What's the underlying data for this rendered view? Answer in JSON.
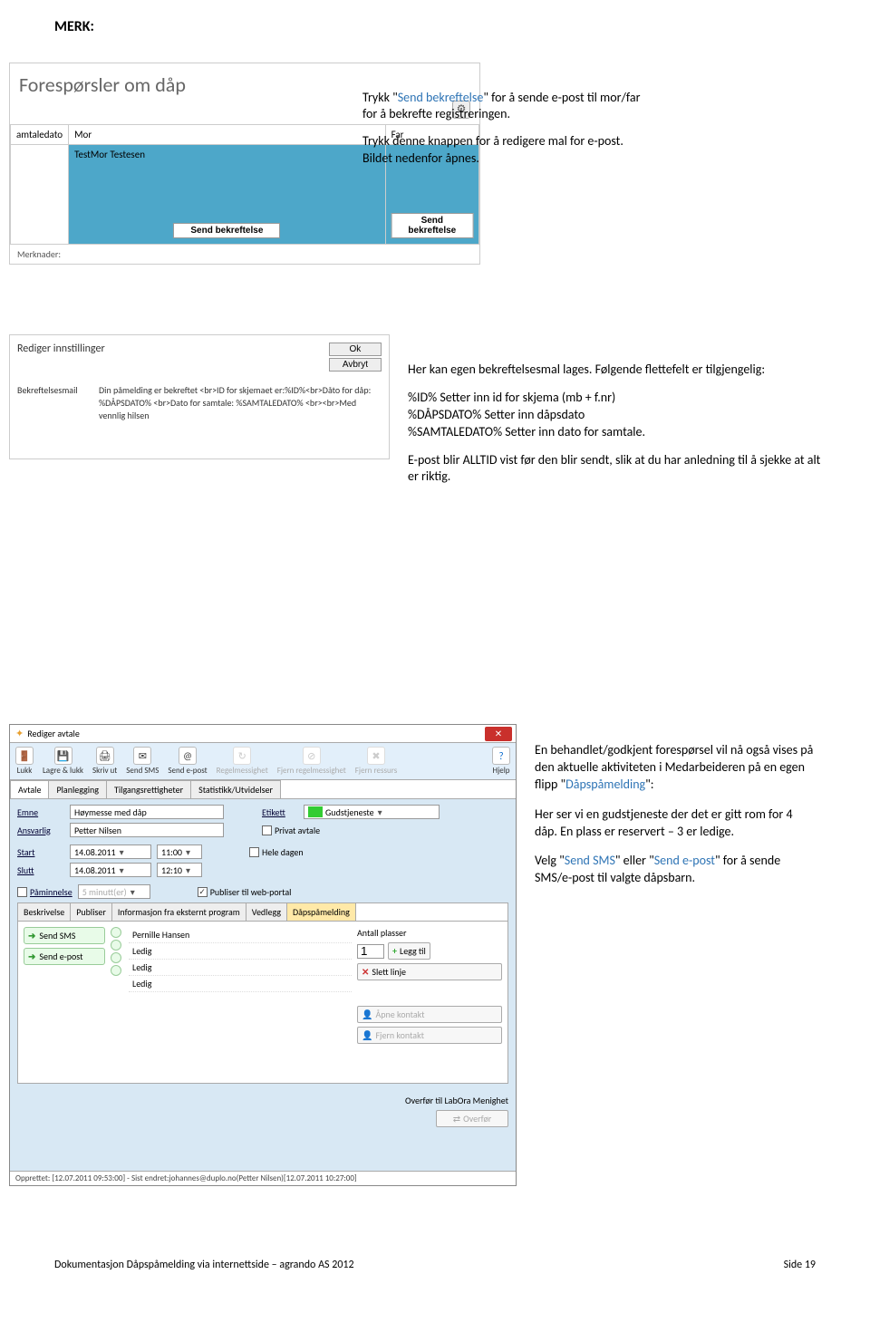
{
  "merk": "MERK:",
  "shot1": {
    "title": "Forespørsler om dåp",
    "gear_icon": "⚙",
    "cols": {
      "c1": "amtaledato",
      "c2": "Mor",
      "c3": "Far"
    },
    "row1_mor": "TestMor  Testesen",
    "send_btn": "Send bekreftelse",
    "merknader": "Merknader:"
  },
  "callout1": {
    "p1a": "Trykk \"",
    "p1b": "Send bekreftelse",
    "p1c": "\" for å sende e-post til mor/far for å bekrefte registreringen.",
    "p2": "Trykk denne knappen for å redigere mal for e-post. Bildet nedenfor åpnes."
  },
  "shot2": {
    "title": "Rediger innstillinger",
    "ok": "Ok",
    "avbryt": "Avbryt",
    "label": "Bekreftelsesmail",
    "value": "Din påmelding er bekreftet <br>ID for skjemaet er:%ID%<br>Dåto for dåp: %DÅPSDATO% <br>Dato for samtale: %SAMTALEDATO% <br><br>Med vennlig hilsen"
  },
  "callout2": {
    "p1": "Her kan egen bekreftelsesmal lages. Følgende flettefelt er tilgjengelig:",
    "l1": "%ID%    Setter inn id for skjema (mb + f.nr)",
    "l2": "%DÅPSDATO%  Setter inn dåpsdato",
    "l3": "%SAMTALEDATO%      Setter inn dato for samtale.",
    "p2": "E-post blir ALLTID vist før den blir sendt, slik at du har anledning til å sjekke at alt er riktig."
  },
  "shot3": {
    "title": "Rediger avtale",
    "toolbar": {
      "lukk": "Lukk",
      "lagre": "Lagre & lukk",
      "skriv": "Skriv ut",
      "sms": "Send SMS",
      "epost": "Send e-post",
      "regel": "Regelmessighet",
      "fjernr": "Fjern regelmessighet",
      "fjernres": "Fjern ressurs",
      "hjelp": "Hjelp"
    },
    "tabs": {
      "avtale": "Avtale",
      "plan": "Planlegging",
      "tilgang": "Tilgangsrettigheter",
      "stat": "Statistikk/Utvidelser"
    },
    "labels": {
      "emne": "Emne",
      "ansvarlig": "Ansvarlig",
      "etikett": "Etikett",
      "start": "Start",
      "slutt": "Slutt",
      "paminnelse": "Påminnelse",
      "privat": "Privat avtale",
      "heledagen": "Hele dagen",
      "publiser": "Publiser til web-portal"
    },
    "values": {
      "emne": "Høymesse med dåp",
      "ansvarlig": "Petter Nilsen",
      "etikett": "Gudstjeneste",
      "startd": "14.08.2011",
      "startt": "11:00",
      "sluttd": "14.08.2011",
      "sluttt": "12:10",
      "paminnelse": "5 minutt(er)"
    },
    "subtabs": {
      "besk": "Beskrivelse",
      "pub": "Publiser",
      "info": "Informasjon fra eksternt program",
      "vedlegg": "Vedlegg",
      "dap": "Dåpspåmelding"
    },
    "leftbtns": {
      "sms": "Send SMS",
      "epost": "Send e-post"
    },
    "list": [
      "Pernille Hansen",
      "Ledig",
      "Ledig",
      "Ledig"
    ],
    "right": {
      "antall_label": "Antall plasser",
      "antall": "1",
      "legg": "Legg til",
      "slett": "Slett linje",
      "apne": "Åpne kontakt",
      "fjern": "Fjern kontakt"
    },
    "lower": {
      "overfor_label": "Overfør til LabOra Menighet",
      "overfor_btn": "Overfør"
    },
    "status": "Opprettet: [12.07.2011 09:53:00] - Sist endret:johannes@duplo.no(Petter Nilsen)[12.07.2011 10:27:00]"
  },
  "callout3": {
    "p1a": "En behandlet/godkjent forespørsel vil nå også vises på den aktuelle aktiviteten i Medarbeideren på en egen flipp \"",
    "p1b": "Dåpspåmelding",
    "p1c": "\":",
    "p2": "Her ser vi en gudstjeneste der det er gitt rom for 4 dåp. En plass er reservert – 3 er ledige.",
    "p3a": "Velg \"",
    "p3b": "Send SMS",
    "p3c": "\" eller \"",
    "p3d": "Send e-post",
    "p3e": "\" for å sende SMS/e-post til valgte dåpsbarn."
  },
  "footer": {
    "left": "Dokumentasjon Dåpspåmelding via internettside – agrando AS 2012",
    "right": "Side 19"
  }
}
